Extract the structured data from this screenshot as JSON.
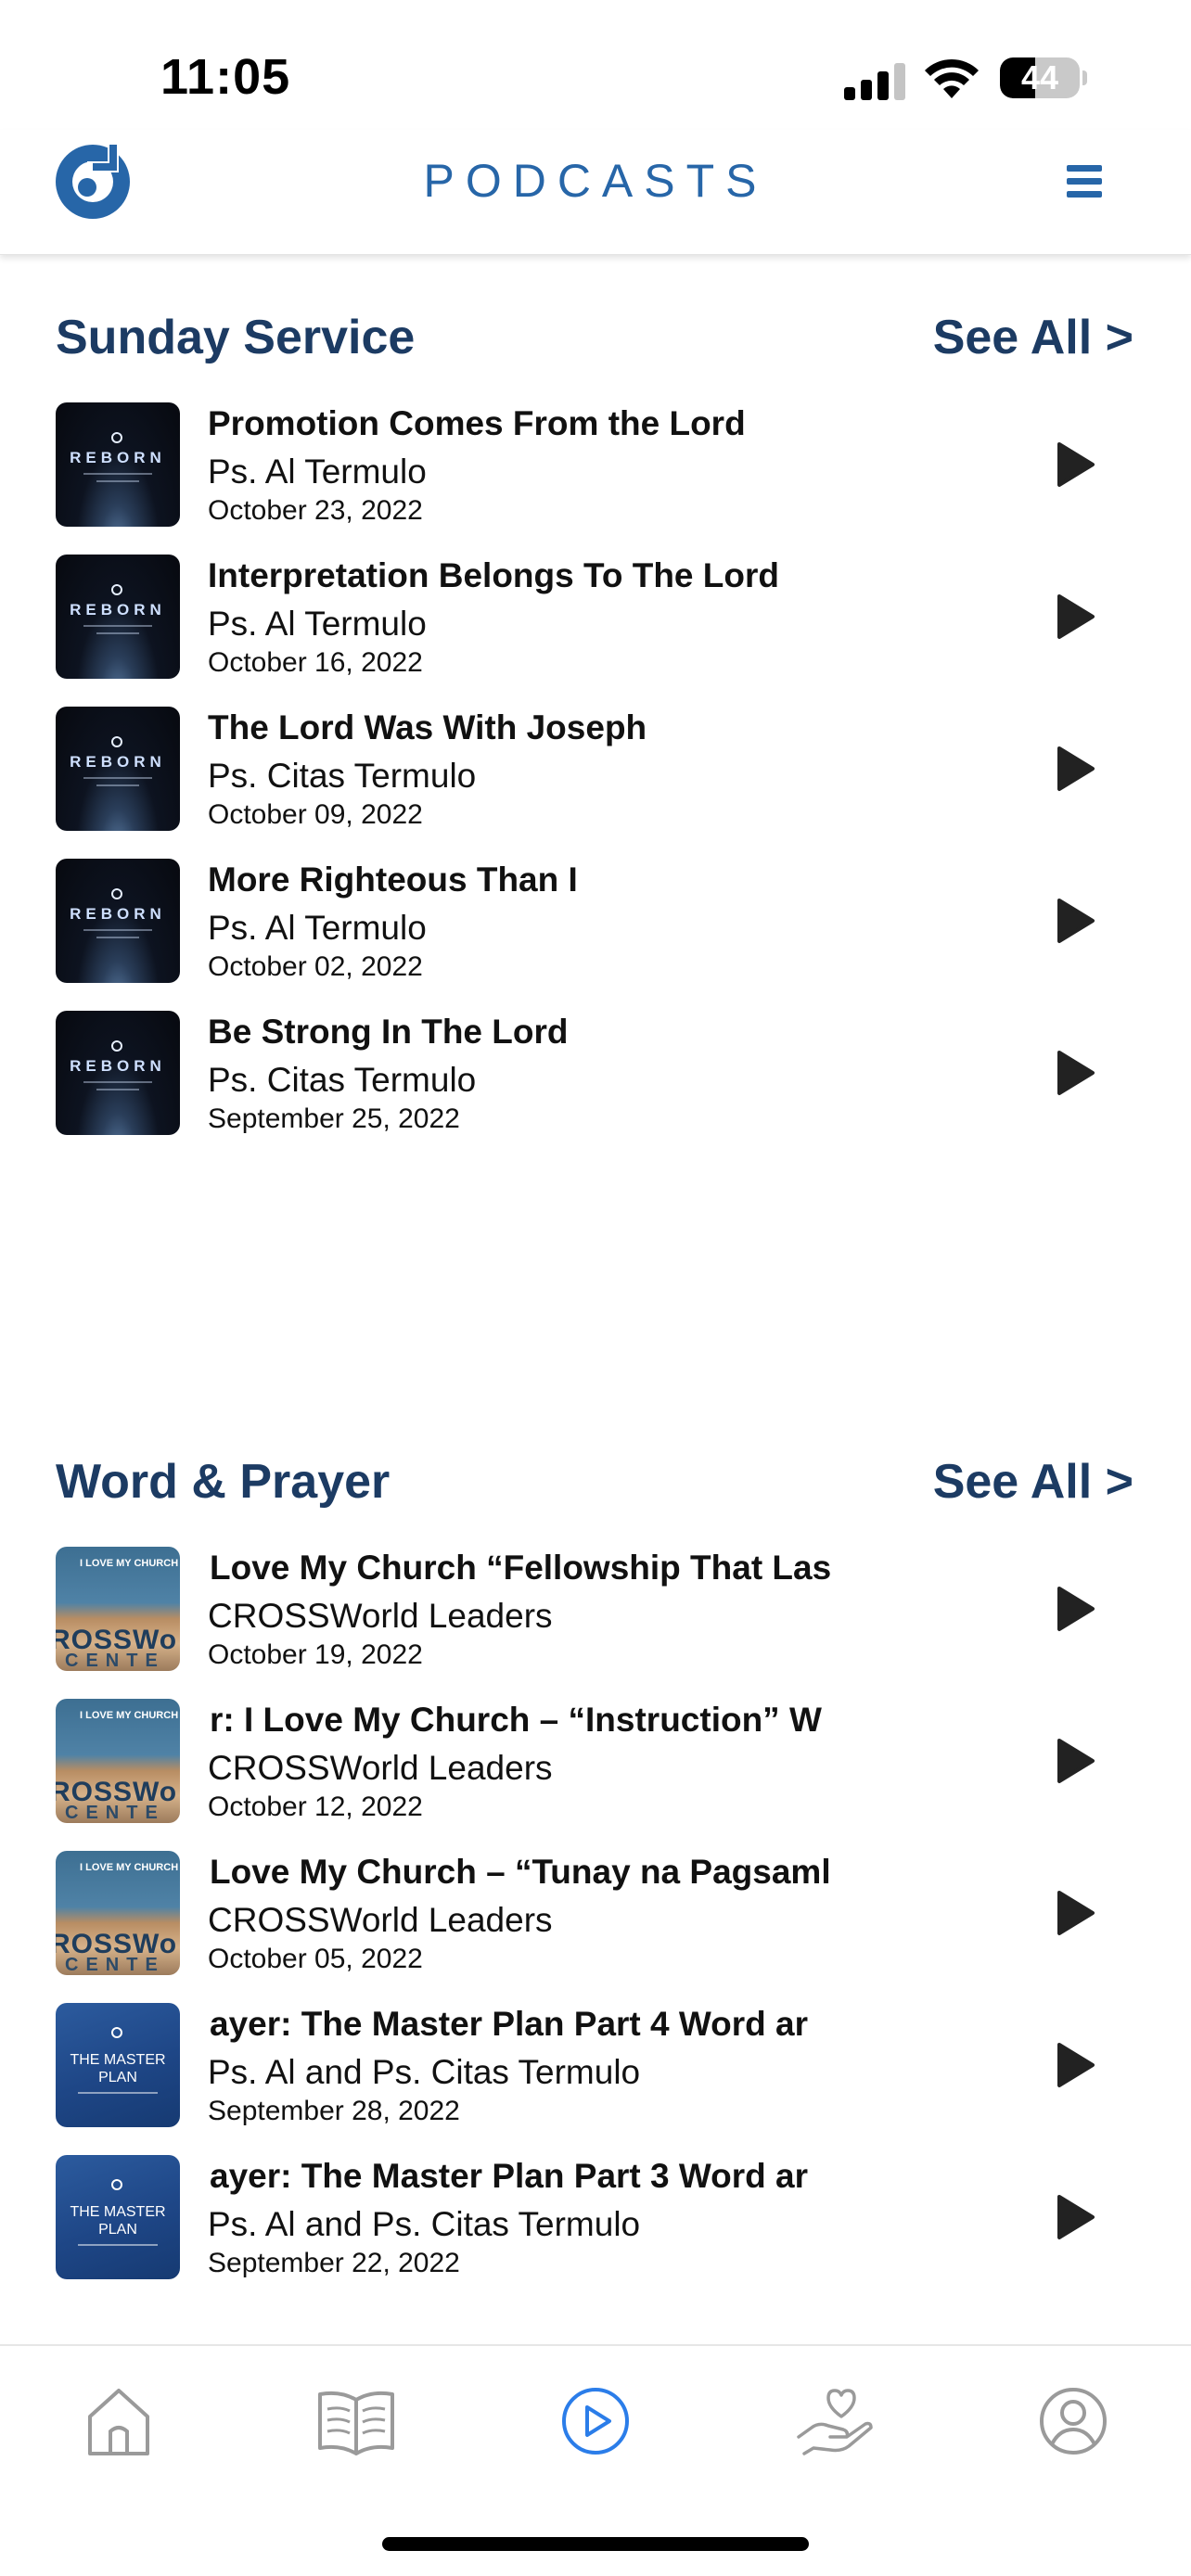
{
  "status_bar": {
    "time": "11:05",
    "battery_percent": "44",
    "battery_level": 0.44,
    "icons": [
      "cellular-signal-icon",
      "wifi-icon",
      "battery-icon"
    ]
  },
  "header": {
    "title": "PODCASTS",
    "logo_icon": "church-logo-icon",
    "menu_icon": "hamburger-menu-icon",
    "accent_color": "#2766a8"
  },
  "sections": [
    {
      "title": "Sunday Service",
      "see_all": "See All >",
      "items": [
        {
          "title": "Promotion Comes From the Lord",
          "speaker": "Ps. Al Termulo",
          "date": "October 23, 2022",
          "thumb_text": "REBORN"
        },
        {
          "title": "Interpretation Belongs To The Lord",
          "speaker": "Ps. Al Termulo",
          "date": "October 16, 2022",
          "thumb_text": "REBORN"
        },
        {
          "title": "The Lord Was With Joseph",
          "speaker": "Ps. Citas Termulo",
          "date": "October 09, 2022",
          "thumb_text": "REBORN"
        },
        {
          "title": "More Righteous Than I",
          "speaker": "Ps. Al Termulo",
          "date": "October 02, 2022",
          "thumb_text": "REBORN"
        },
        {
          "title": "Be Strong In The Lord",
          "speaker": "Ps. Citas Termulo",
          "date": "September 25, 2022",
          "thumb_text": "REBORN"
        }
      ]
    },
    {
      "title": "Word & Prayer",
      "see_all": "See All >",
      "items": [
        {
          "title": "Love My Church “Fellowship That Las",
          "speaker": "CROSSWorld Leaders",
          "date": "October 19, 2022",
          "thumb_top": "I LOVE MY CHURCH",
          "thumb_big": "ROSSWo",
          "thumb_small": "CENTE"
        },
        {
          "title": "r: I Love My Church – “Instruction”   W",
          "speaker": "CROSSWorld Leaders",
          "date": "October 12, 2022",
          "thumb_top": "I LOVE MY CHURCH",
          "thumb_big": "ROSSWo",
          "thumb_small": "CENTE"
        },
        {
          "title": "Love My Church – “Tunay na Pagsaml",
          "speaker": "CROSSWorld Leaders",
          "date": "October 05, 2022",
          "thumb_top": "I LOVE MY CHURCH",
          "thumb_big": "ROSSWo",
          "thumb_small": "CENTE"
        },
        {
          "title": "ayer: The Master Plan Part 4   Word ar",
          "speaker": "Ps. Al and Ps. Citas Termulo",
          "date": "September 28, 2022",
          "thumb_text": "THE MASTER PLAN"
        },
        {
          "title": "ayer: The Master Plan Part 3   Word ar",
          "speaker": "Ps. Al and Ps. Citas Termulo",
          "date": "September 22, 2022",
          "thumb_text": "THE MASTER PLAN"
        }
      ]
    }
  ],
  "tab_bar": {
    "tabs": [
      {
        "name": "home",
        "icon": "home-icon",
        "active": false
      },
      {
        "name": "bible",
        "icon": "book-icon",
        "active": false
      },
      {
        "name": "podcasts",
        "icon": "play-circle-icon",
        "active": true
      },
      {
        "name": "give",
        "icon": "heart-hand-icon",
        "active": false
      },
      {
        "name": "profile",
        "icon": "user-circle-icon",
        "active": false
      }
    ],
    "active_color": "#2b7de9",
    "inactive_color": "#9a9a9a"
  }
}
